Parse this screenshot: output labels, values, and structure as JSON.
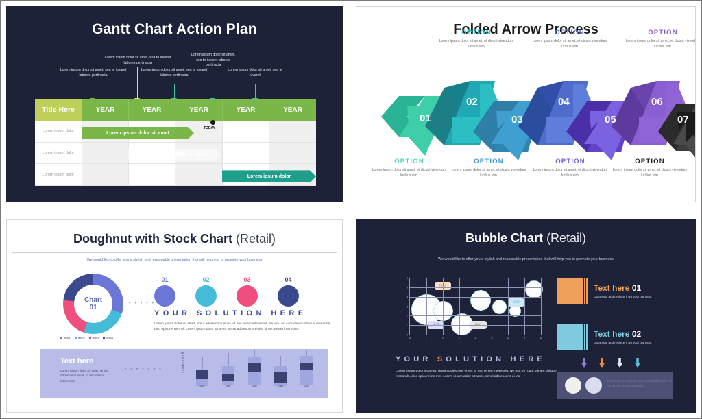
{
  "slides": {
    "gantt": {
      "title": "Gantt Chart Action Plan",
      "annotations": [
        {
          "text": "Lorem ipsum dolor sit amet, sea te iuvaret labores pertinacia",
          "color": "#7ab648"
        },
        {
          "text": "Lorem ipsum dolor sit amet, sea te iuvaret labores pertinacia",
          "color": "#dbe05a"
        },
        {
          "text": "Lorem ipsum dolor sit amet, sea te iuvaret labores pertinacia",
          "color": "#3ec6a0"
        },
        {
          "text": "Lorem ipsum dolor sit amet, sea te iuvaret labores pertinacia",
          "color": "#2ec4d8"
        },
        {
          "text": "Lorem ipsum dolor sit amet, sea te iuvaret",
          "color": "#2ec4d8"
        }
      ],
      "header": [
        "Title Here",
        "YEAR",
        "YEAR",
        "YEAR",
        "YEAR",
        "YEAR"
      ],
      "rows": [
        {
          "label": "Lorem ipsum dolor",
          "bar": "Lorem ipsum dolor sit amet"
        },
        {
          "label": "Lorem ipsum dolor",
          "bar": "Lorem ipsum dolor sit amet"
        },
        {
          "label": "Lorem ipsum dolor",
          "bar": "Lorem ipsum dolor"
        }
      ],
      "today_label": "TODAY"
    },
    "arrow": {
      "title": "Folded Arrow Process",
      "steps": [
        {
          "number": "01",
          "option": "OPTION",
          "desc": "Lorem ipsum dolor sit amet, et dicunt vivendum lucilius vim.",
          "color": "#3ecfa8",
          "dark": "#1f9e8c",
          "text_color": "#4fd6c0",
          "pos": "bottom"
        },
        {
          "number": "02",
          "option": "OPTION",
          "desc": "Lorem ipsum dolor sit amet, et dicunt vivendum lucilius vim.",
          "color": "#2bbfc4",
          "dark": "#1a7d86",
          "text_color": "#37c6cd",
          "pos": "top"
        },
        {
          "number": "03",
          "option": "OPTION",
          "desc": "Lorem ipsum dolor sit amet, et dicunt vivendum lucilius vim.",
          "color": "#3f9fd0",
          "dark": "#2b6f96",
          "text_color": "#3f97cf",
          "pos": "bottom"
        },
        {
          "number": "04",
          "option": "OPTION",
          "desc": "Lorem ipsum dolor sit amet, et dicunt vivendum lucilius vim.",
          "color": "#5d7fdb",
          "dark": "#2f4fa8",
          "text_color": "#5472d6",
          "pos": "top"
        },
        {
          "number": "05",
          "option": "OPTION",
          "desc": "Lorem ipsum dolor sit amet, et dicunt vivendum lucilius vim.",
          "color": "#7b62e0",
          "dark": "#4a2fa8",
          "text_color": "#6f5ce0",
          "pos": "bottom"
        },
        {
          "number": "06",
          "option": "OPTION",
          "desc": "Lorem ipsum dolor sit amet, et dicunt vivendum lucilius vim.",
          "color": "#9063d6",
          "dark": "#5d3b9e",
          "text_color": "#8a5fd2",
          "pos": "top"
        },
        {
          "number": "07",
          "option": "OPTION",
          "desc": "Lorem ipsum dolor sit amet, et dicunt vivendum lucilius vim.",
          "color": "#4a4a4a",
          "dark": "#1c1c1c",
          "text_color": "#1c1c1c",
          "pos": "bottom"
        }
      ]
    },
    "doughnut": {
      "title_bold": "Doughnut with Stock Chart",
      "title_thin": "(Retail)",
      "subtitle": "We would like to offer you a stylish and reasonable presentation that will help you to promote your business",
      "center_line1": "Chart",
      "center_line2": "01",
      "solution_heading": "YOUR SOLUTION HERE",
      "solution_body": "Lorem ipsum dolor sit amet, simul adolescens ei vis, id nec errem interesset. Ne usu. An cum utinam oblique menandri, dico epicurei ne mel. Lorem ipsum dolor sit amet, simul adolescens ei vis, id nec errem interesset.",
      "panel_title": "Text here",
      "panel_body": "Lorem ipsum dolor sit amet, simul adolescens ei vis, id nec errem interesset.",
      "circles": [
        {
          "num": "01",
          "color": "#6b76d6"
        },
        {
          "num": "02",
          "color": "#44bcd8"
        },
        {
          "num": "03",
          "color": "#ef4f7e"
        },
        {
          "num": "04",
          "color": "#3b4a8c"
        }
      ],
      "chart_data": {
        "type": "pie",
        "title": "Chart 01",
        "categories": [
          "text01",
          "text02",
          "text03",
          "text04"
        ],
        "values": [
          30,
          25,
          22,
          23
        ],
        "colors": [
          "#6b76d6",
          "#44bcd8",
          "#ef4f7e",
          "#3b4a8c"
        ],
        "legend": "bottom-left",
        "stock": {
          "type": "bar",
          "categories": [
            "text01",
            "text02",
            "text03",
            "text04",
            "text05"
          ],
          "open": [
            58,
            46,
            62,
            55,
            60
          ],
          "close": [
            40,
            60,
            78,
            35,
            72
          ],
          "high": [
            75,
            85,
            88,
            74,
            90
          ],
          "low": [
            28,
            38,
            44,
            24,
            48
          ],
          "ylim": [
            0,
            100
          ],
          "yticks": [
            "100",
            "90",
            "80",
            "70",
            "60",
            "50",
            "40",
            "30",
            "20",
            "10",
            "0"
          ]
        }
      }
    },
    "bubble": {
      "title_bold": "Bubble Chart",
      "title_thin": "(Retail)",
      "subtitle": "We would like to offer you a stylish and reasonable presentation that will help you to promote your business",
      "solution_heading": "YOUR SOLUTION HERE",
      "solution_body": "Lorem ipsum dolor sit amet, simul adolescens ei vis, id nec errem interesset. Ne usu. An cum utinam oblique menandri, dico epicurei ne mel. Lorem ipsum dolor sit amet, simul adolescens ei vis.",
      "legend": [
        {
          "heading_1": "Text here",
          "heading_2": "01",
          "body": "Go ahead and replace it wit your own text",
          "color": "#f0a05a"
        },
        {
          "heading_1": "Text here",
          "heading_2": "02",
          "body": "Go ahead and replace it wit your own text",
          "color": "#7ecbe0"
        }
      ],
      "arrows": [
        "#8d7fd6",
        "#ef8a3c",
        "#e8eaf4",
        "#58bcd8"
      ],
      "footer_text": "Lorem ipsum dolor sit amet, simul adolescens ei vis, id nec errem interesset.",
      "callouts": [
        {
          "text": "text",
          "bg": "#fde0c8",
          "color": "#ef8a3c"
        },
        {
          "text": "text",
          "bg": "#cfe9f2",
          "color": "#58bcd8"
        },
        {
          "text": "text",
          "bg": "#dcdcf2",
          "color": "#7b7fd6"
        },
        {
          "text": "text",
          "bg": "#e6e6e6",
          "color": "#9a9a9a"
        }
      ],
      "chart_data": {
        "type": "scatter",
        "xlabel": "",
        "ylabel": "",
        "xlim": [
          0,
          8
        ],
        "ylim": [
          0,
          6
        ],
        "xticks": [
          "0",
          "1",
          "2",
          "3",
          "4",
          "5",
          "6",
          "7",
          "8"
        ],
        "yticks": [
          "0",
          "1",
          "2",
          "3",
          "4",
          "5",
          "6"
        ],
        "grid": true,
        "points": [
          {
            "x": 0.8,
            "y": 3.0,
            "r": 1.1
          },
          {
            "x": 2.0,
            "y": 2.7,
            "r": 0.68
          },
          {
            "x": 3.1,
            "y": 1.0,
            "r": 0.78
          },
          {
            "x": 4.0,
            "y": 3.7,
            "r": 0.72
          },
          {
            "x": 5.1,
            "y": 3.0,
            "r": 0.5
          },
          {
            "x": 6.1,
            "y": 2.4,
            "r": 0.4
          },
          {
            "x": 7.0,
            "y": 5.0,
            "r": 0.62
          }
        ]
      }
    }
  }
}
